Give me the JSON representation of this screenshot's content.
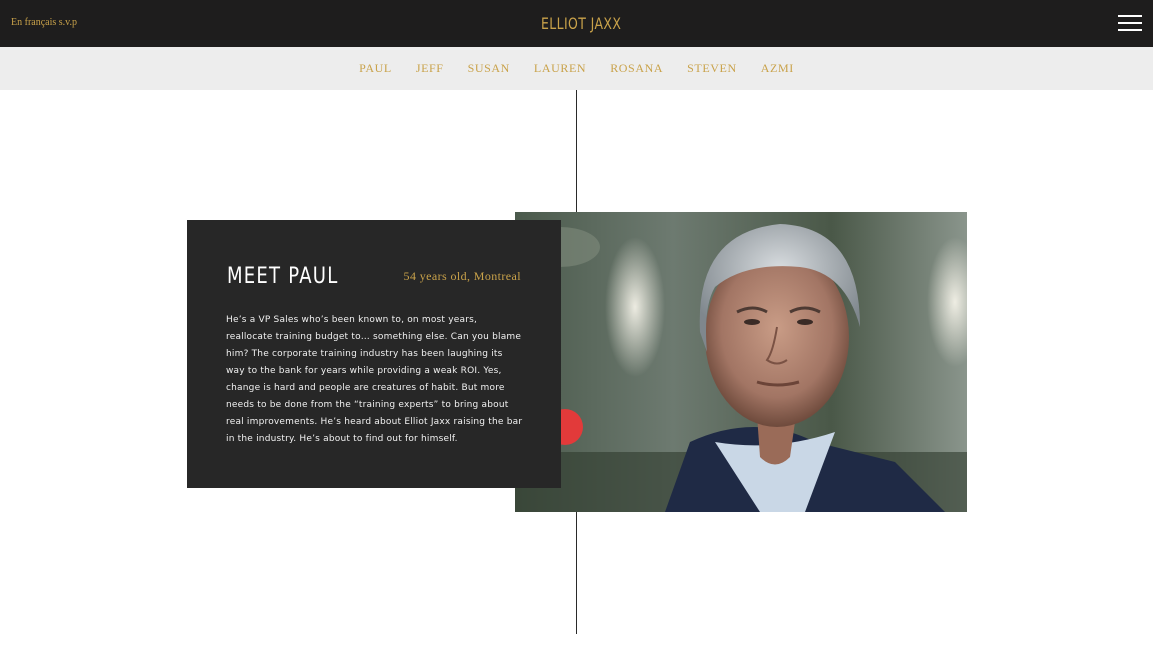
{
  "header": {
    "lang_link": "En français s.v.p",
    "logo_text": "ELLIOT JAXX",
    "menu_icon": "hamburger-menu-icon"
  },
  "subnav": {
    "items": [
      "PAUL",
      "JEFF",
      "SUSAN",
      "LAUREN",
      "ROSANA",
      "STEVEN",
      "AZMI"
    ]
  },
  "profile": {
    "title": "MEET PAUL",
    "subtitle": "54 years old, Montreal",
    "body": "He’s a VP Sales who’s been known to, on most years, reallocate training budget to… something else. Can you blame him? The corporate training industry has been laughing its way to the bank for years while providing a weak ROI. Yes, change is hard and people are creatures of habit. But more needs to be done from the “training experts” to bring about real improvements. He’s heard about Elliot Jaxx raising the bar in the industry. He’s about to find out for himself."
  },
  "colors": {
    "topbar": "#1e1d1d",
    "accent_gold": "#c9a24a",
    "subnav_bg": "#ededed",
    "card_bg": "#272727"
  }
}
